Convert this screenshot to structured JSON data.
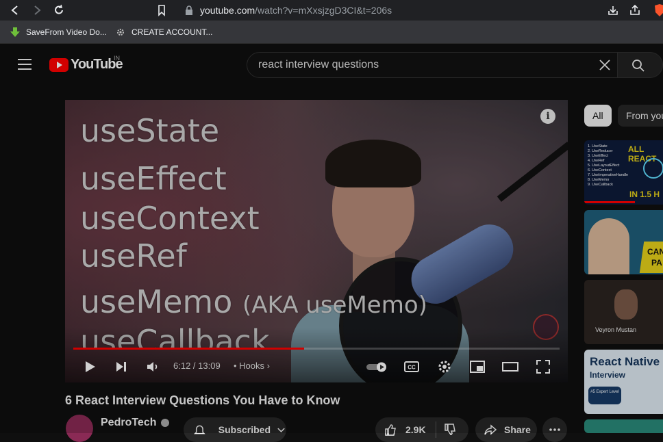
{
  "browser": {
    "url_host": "youtube.com",
    "url_path": "/watch?v=mXxsjzgD3CI&t=206s",
    "bookmarks": [
      {
        "label": "SaveFrom Video Do..."
      },
      {
        "label": "CREATE ACCOUNT..."
      }
    ]
  },
  "masthead": {
    "logo_text": "YouTube",
    "region": "IN",
    "search_value": "react interview questions"
  },
  "player": {
    "overlay_lines": [
      "useState",
      "useEffect",
      "useContext",
      "useRef",
      "useMemo",
      "useCallback"
    ],
    "overlay_aka": "(AKA useMemo)",
    "info_glyph": "i",
    "time": "6:12 / 13:09",
    "chapter": "• Hooks",
    "progress": 0.474,
    "accent": "#ff0000"
  },
  "video": {
    "title": "6 React Interview Questions You Have to Know",
    "channel": "PedroTech",
    "subscribe_label": "Subscribed",
    "like_count": "2.9K",
    "share_label": "Share"
  },
  "sidebar": {
    "chips": [
      {
        "label": "All",
        "active": true
      },
      {
        "label": "From you",
        "active": false
      }
    ],
    "thumbs": [
      {
        "list": [
          "1. UseState",
          "2. UseReducer",
          "3. UseEffect",
          "4. UseRef",
          "5. UseLayoutEffect",
          "6. UseContext",
          "7. UseImperativeHandle",
          "8. UseMemo",
          "9. UseCallback"
        ],
        "headline": "ALL REACT",
        "footer": "IN 1.5 H"
      },
      {
        "headline": "CAN",
        "sub": "PA"
      },
      {
        "name": "Veyron Mustan"
      },
      {
        "title": "React Native",
        "sub": "Interview",
        "badge": "#5 Expert Level"
      }
    ]
  }
}
